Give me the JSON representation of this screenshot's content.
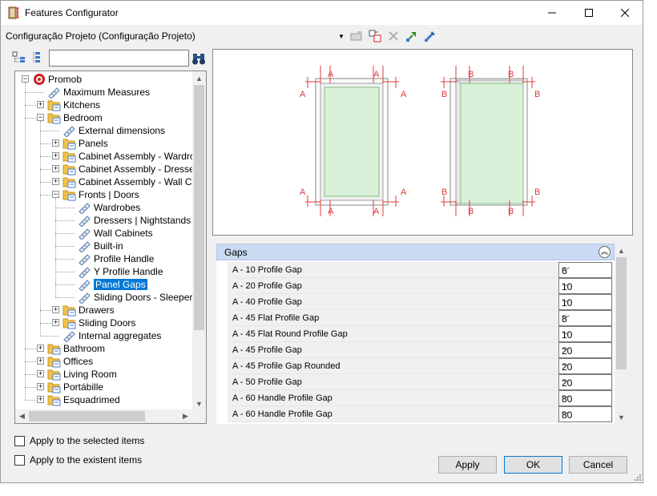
{
  "window": {
    "title": "Features Configurator"
  },
  "config": {
    "label": "Configuração Projeto (Configuração Projeto)",
    "toolbar_icons": [
      "dropdown-icon",
      "import-icon",
      "copy-icon",
      "delete-icon",
      "export-icon",
      "edit-icon"
    ]
  },
  "tree": {
    "search_value": "",
    "items": [
      {
        "label": "Promob",
        "level": 0,
        "expander": "-",
        "icon": "promob-logo"
      },
      {
        "label": "Maximum Measures",
        "level": 1,
        "expander": "",
        "icon": "ruler"
      },
      {
        "label": "Kitchens",
        "level": 1,
        "expander": "+",
        "icon": "folder"
      },
      {
        "label": "Bedroom",
        "level": 1,
        "expander": "-",
        "icon": "folder"
      },
      {
        "label": "External dimensions",
        "level": 2,
        "expander": "",
        "icon": "ruler"
      },
      {
        "label": "Panels",
        "level": 2,
        "expander": "+",
        "icon": "folder"
      },
      {
        "label": "Cabinet Assembly - Wardrobe",
        "level": 2,
        "expander": "+",
        "icon": "folder"
      },
      {
        "label": "Cabinet Assembly - Dressers |",
        "level": 2,
        "expander": "+",
        "icon": "folder"
      },
      {
        "label": "Cabinet Assembly - Wall Cabi",
        "level": 2,
        "expander": "+",
        "icon": "folder"
      },
      {
        "label": "Fronts | Doors",
        "level": 2,
        "expander": "-",
        "icon": "folder"
      },
      {
        "label": "Wardrobes",
        "level": 3,
        "expander": "",
        "icon": "ruler"
      },
      {
        "label": "Dressers | Nightstands",
        "level": 3,
        "expander": "",
        "icon": "ruler"
      },
      {
        "label": "Wall Cabinets",
        "level": 3,
        "expander": "",
        "icon": "ruler"
      },
      {
        "label": "Built-in",
        "level": 3,
        "expander": "",
        "icon": "ruler"
      },
      {
        "label": "Profile Handle",
        "level": 3,
        "expander": "",
        "icon": "ruler"
      },
      {
        "label": "Y Profile Handle",
        "level": 3,
        "expander": "",
        "icon": "ruler"
      },
      {
        "label": "Panel Gaps",
        "level": 3,
        "expander": "",
        "icon": "ruler",
        "selected": true
      },
      {
        "label": "Sliding Doors - Sleepers",
        "level": 3,
        "expander": "",
        "icon": "ruler"
      },
      {
        "label": "Drawers",
        "level": 2,
        "expander": "+",
        "icon": "folder"
      },
      {
        "label": "Sliding Doors",
        "level": 2,
        "expander": "+",
        "icon": "folder"
      },
      {
        "label": "Internal aggregates",
        "level": 2,
        "expander": "",
        "icon": "ruler"
      },
      {
        "label": "Bathroom",
        "level": 1,
        "expander": "+",
        "icon": "folder"
      },
      {
        "label": "Offices",
        "level": 1,
        "expander": "+",
        "icon": "folder"
      },
      {
        "label": "Living Room",
        "level": 1,
        "expander": "+",
        "icon": "folder"
      },
      {
        "label": "Portábille",
        "level": 1,
        "expander": "+",
        "icon": "folder"
      },
      {
        "label": "Esquadrimed",
        "level": 1,
        "expander": "+",
        "icon": "folder"
      }
    ]
  },
  "preview": {
    "label_a": "A",
    "label_b": "B",
    "accent_color": "#e03a3a",
    "panel_fill": "#d9f0d9"
  },
  "grid": {
    "section": "Gaps",
    "rows": [
      {
        "label": "A - 10 Profile Gap",
        "value": "6"
      },
      {
        "label": "A - 20 Profile Gap",
        "value": "10"
      },
      {
        "label": "A - 40 Profile Gap",
        "value": "10"
      },
      {
        "label": "A - 45 Flat Profile Gap",
        "value": "8"
      },
      {
        "label": "A - 45 Flat Round Profile Gap",
        "value": "10"
      },
      {
        "label": "A - 45 Profile Gap",
        "value": "20"
      },
      {
        "label": "A - 45 Profile Gap Rounded",
        "value": "20"
      },
      {
        "label": "A - 50 Profile Gap",
        "value": "20"
      },
      {
        "label": "A - 60 Handle Profile Gap",
        "value": "80"
      },
      {
        "label": "A - 60 Handle Profile Gap",
        "value": "80"
      }
    ]
  },
  "options": {
    "apply_selected": "Apply to the selected items",
    "apply_existent": "Apply to the existent items"
  },
  "buttons": {
    "apply": "Apply",
    "ok": "OK",
    "cancel": "Cancel"
  }
}
